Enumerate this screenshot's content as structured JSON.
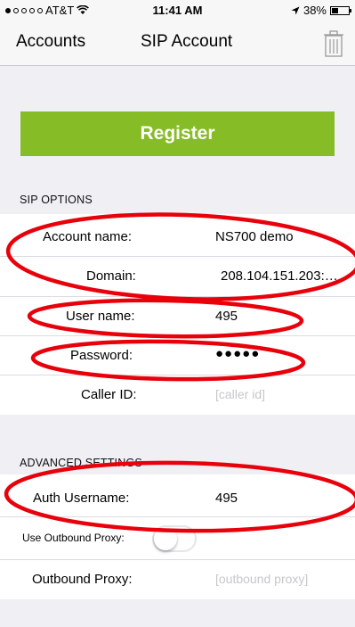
{
  "status_bar": {
    "carrier": "AT&T",
    "time": "11:41 AM",
    "battery": "38%",
    "battery_level": 0.38
  },
  "nav": {
    "back_label": "Accounts",
    "title": "SIP Account"
  },
  "register_button": "Register",
  "sip_options": {
    "header": "SIP OPTIONS",
    "account_name_label": "Account name:",
    "account_name_value": "NS700 demo",
    "domain_label": "Domain:",
    "domain_value": "208.104.151.203:…",
    "user_name_label": "User name:",
    "user_name_value": "495",
    "password_label": "Password:",
    "password_value": "●●●●●",
    "caller_id_label": "Caller ID:",
    "caller_id_placeholder": "[caller id]"
  },
  "advanced": {
    "header": "ADVANCED SETTINGS",
    "auth_username_label": "Auth Username:",
    "auth_username_value": "495",
    "outbound_proxy_toggle_label": "Use Outbound Proxy:",
    "outbound_proxy_toggle_on": false,
    "outbound_proxy_label": "Outbound Proxy:",
    "outbound_proxy_placeholder": "[outbound proxy]"
  },
  "colors": {
    "register": "#86bc25",
    "annotation": "#e8000b"
  }
}
